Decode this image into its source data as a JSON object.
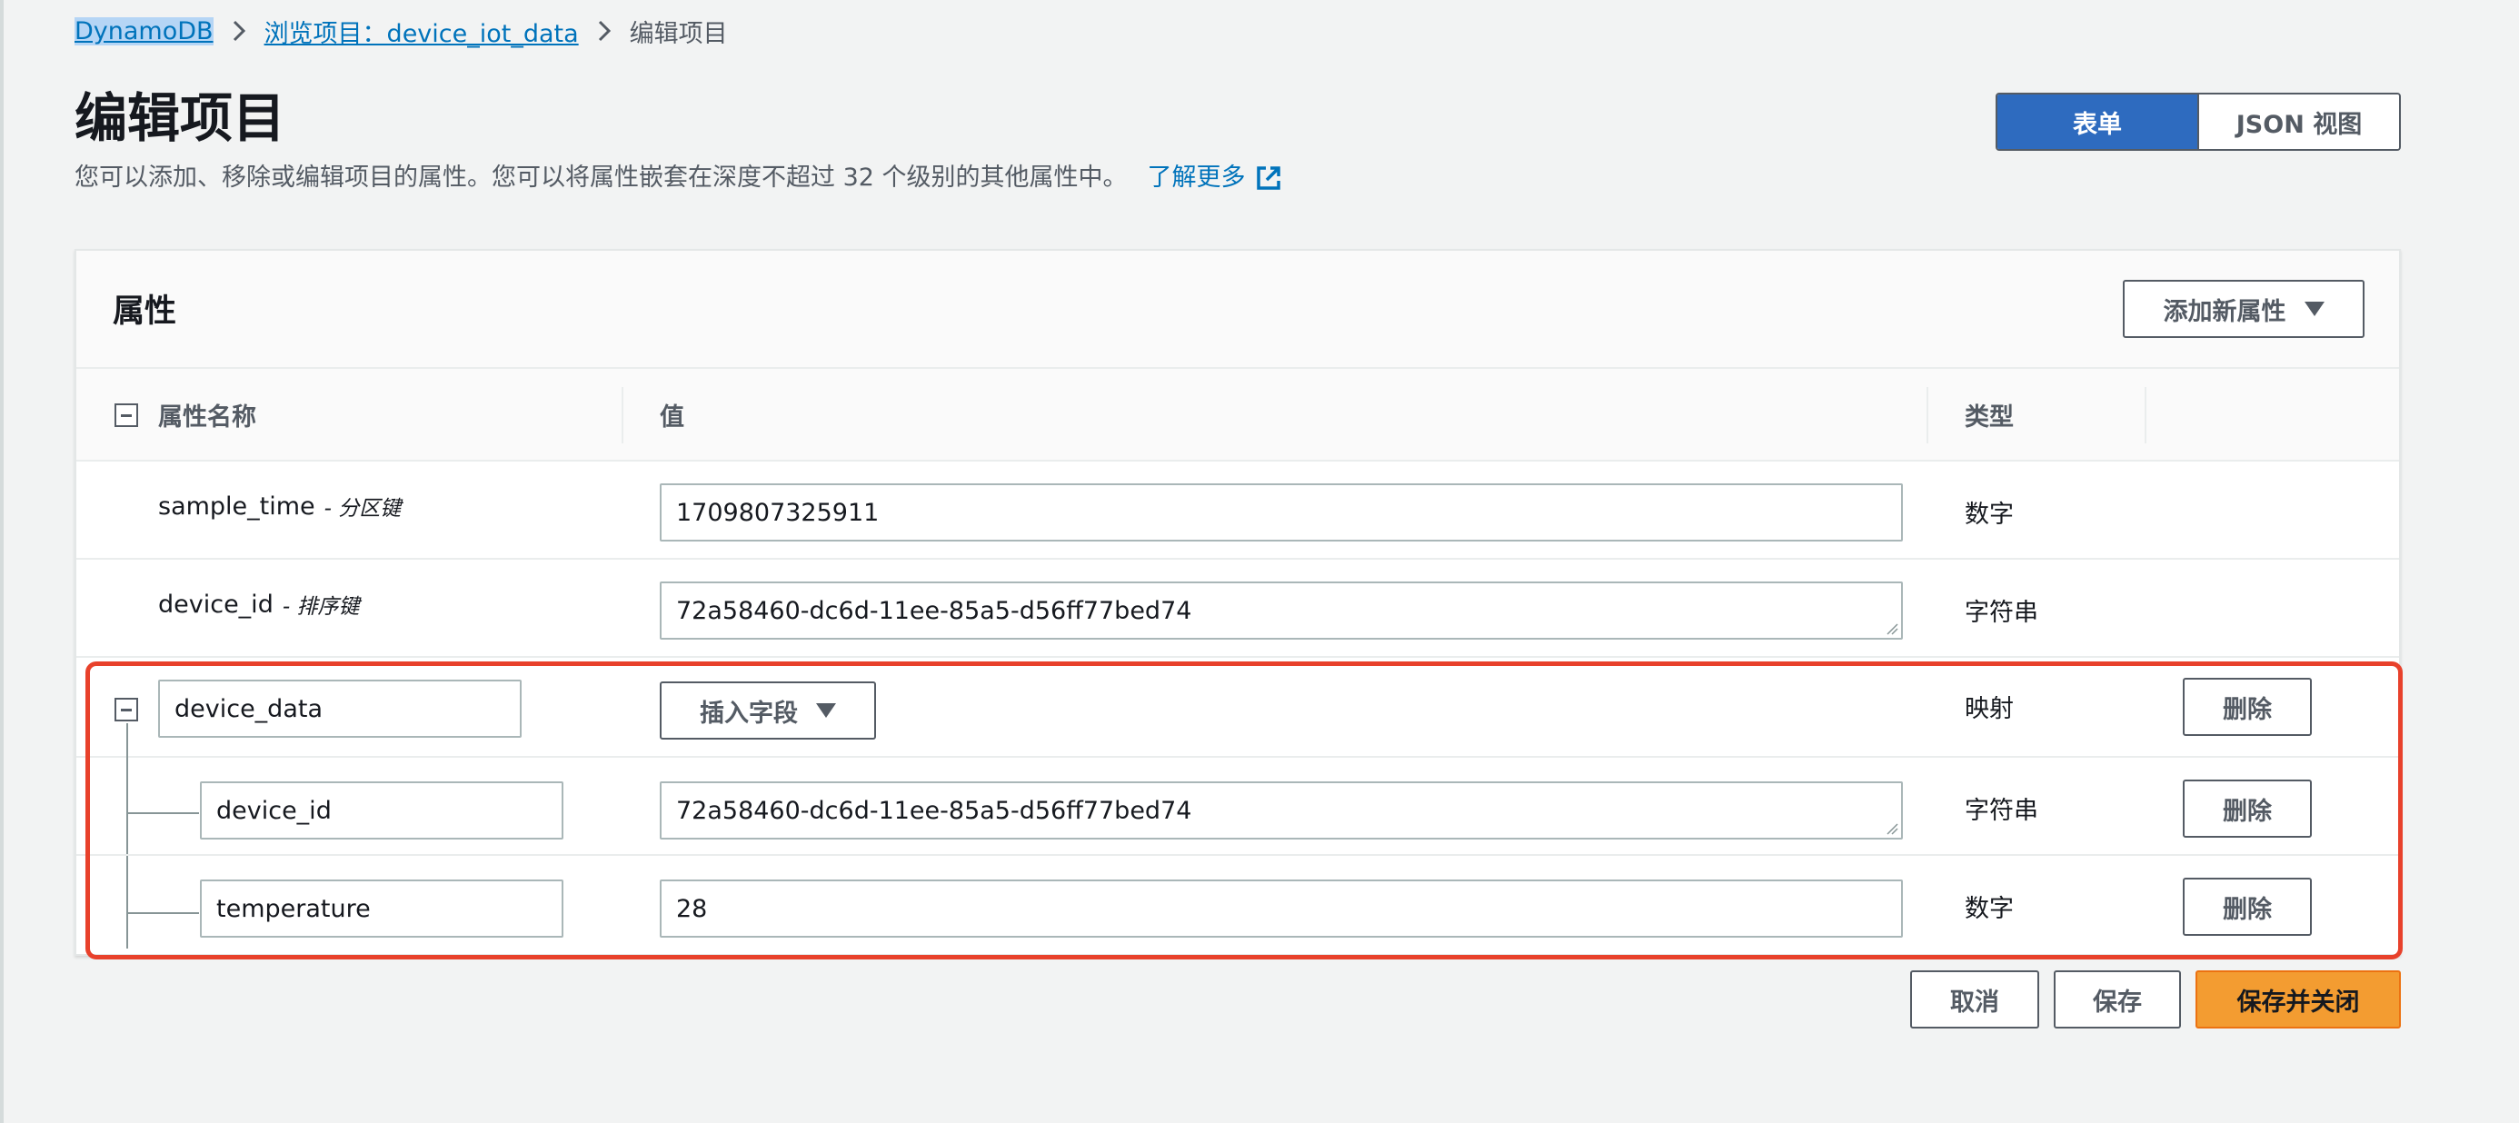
{
  "breadcrumb": {
    "root": "DynamoDB",
    "parent": "浏览项目：device_iot_data",
    "current": "编辑项目"
  },
  "header": {
    "title": "编辑项目",
    "description": "您可以添加、移除或编辑项目的属性。您可以将属性嵌套在深度不超过 32 个级别的其他属性中。",
    "learn_more": "了解更多"
  },
  "view_toggle": {
    "form_label": "表单",
    "json_label": "JSON 视图",
    "active": "form"
  },
  "panel": {
    "title": "属性",
    "add_attribute_label": "添加新属性"
  },
  "columns": {
    "name": "属性名称",
    "value": "值",
    "type": "类型"
  },
  "rows": [
    {
      "name": "sample_time",
      "key_label": "- 分区键",
      "value": "1709807325911",
      "type": "数字"
    },
    {
      "name": "device_id",
      "key_label": "- 排序键",
      "value": "72a58460-dc6d-11ee-85a5-d56ff77bed74",
      "type": "字符串"
    }
  ],
  "map_attribute": {
    "name": "device_data",
    "insert_field_label": "插入字段",
    "type": "映射",
    "remove_label": "删除",
    "children": [
      {
        "name": "device_id",
        "value": "72a58460-dc6d-11ee-85a5-d56ff77bed74",
        "type": "字符串",
        "remove_label": "删除"
      },
      {
        "name": "temperature",
        "value": "28",
        "type": "数字",
        "remove_label": "删除"
      }
    ]
  },
  "footer": {
    "cancel_label": "取消",
    "save_label": "保存",
    "save_close_label": "保存并关闭"
  },
  "colors": {
    "link": "#0073bb",
    "primary_button": "#f39c31",
    "toggle_active": "#2e6bbf",
    "highlight": "#e8412b"
  }
}
